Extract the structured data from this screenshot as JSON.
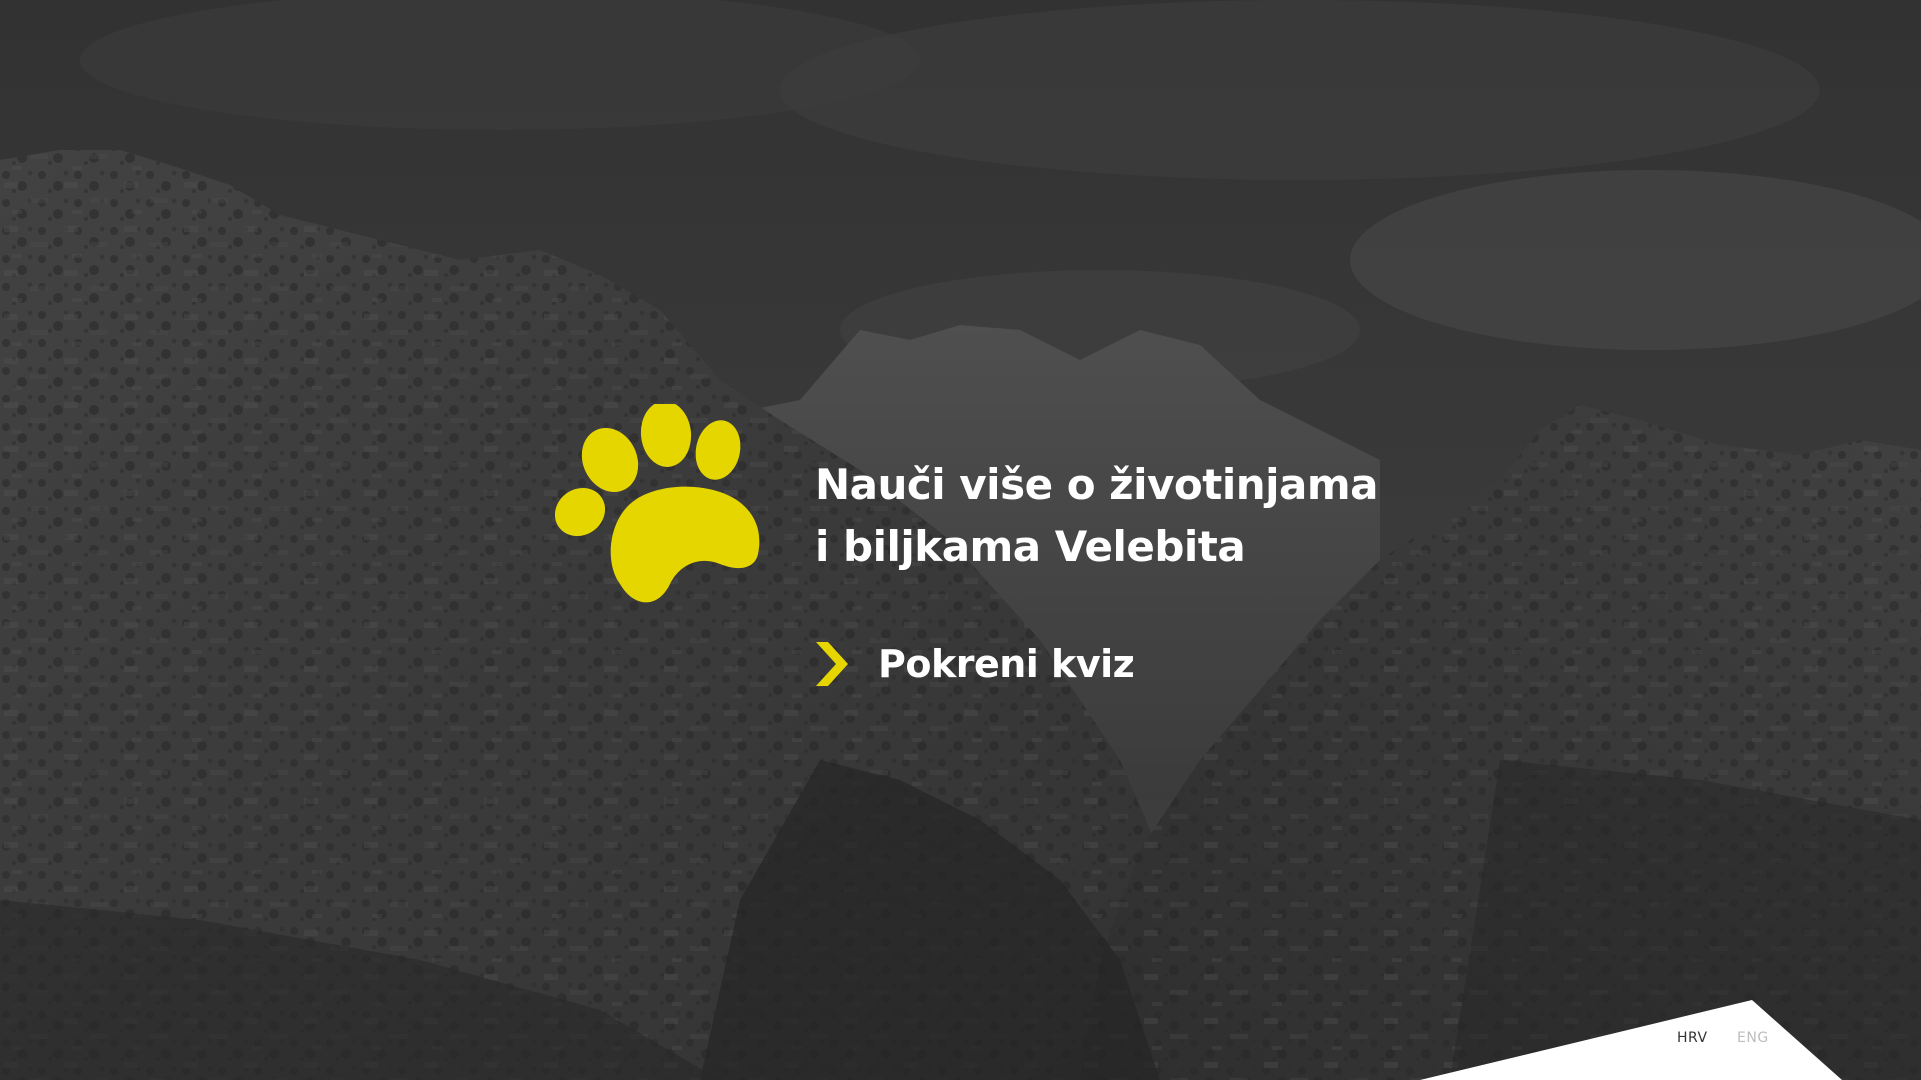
{
  "hero": {
    "title_line1": "Nauči više o životinjama",
    "title_line2": "i biljkama Velebita",
    "start_label": "Pokreni kviz"
  },
  "language": {
    "options": [
      "HRV",
      "ENG"
    ],
    "active": "HRV"
  },
  "icons": {
    "logo": "paw-icon",
    "start": "chevron-right-icon"
  },
  "colors": {
    "accent": "#e6d600",
    "background": "#3c3c3c",
    "text": "#ffffff",
    "lang_active": "#333333",
    "lang_inactive": "#bdbdbd"
  }
}
